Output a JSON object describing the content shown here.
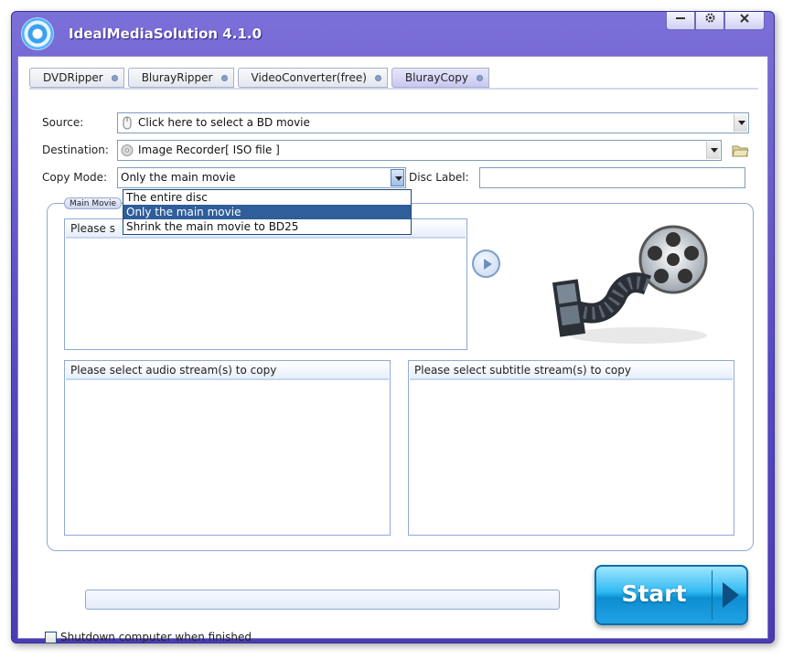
{
  "app": {
    "title": "IdealMediaSolution  4.1.0"
  },
  "window_controls": {
    "minimize_icon": "minimize-icon",
    "settings_icon": "gear-icon",
    "close_icon": "close-icon"
  },
  "tabs": [
    {
      "label": "DVDRipper",
      "active": false
    },
    {
      "label": "BlurayRipper",
      "active": false
    },
    {
      "label": "VideoConverter(free)",
      "active": false
    },
    {
      "label": "BlurayCopy",
      "active": true
    }
  ],
  "source": {
    "label": "Source:",
    "value": "Click here to select a BD movie",
    "icon": "mouse-icon"
  },
  "destination": {
    "label": "Destination:",
    "value": "Image Recorder[ ISO file ]",
    "icon": "disc-icon",
    "browse_icon": "folder-icon"
  },
  "copy_mode": {
    "label": "Copy Mode:",
    "value": "Only the main movie",
    "options": [
      "The entire disc",
      "Only the main movie",
      "Shrink the main movie to BD25"
    ],
    "selected_index": 1
  },
  "disc_label": {
    "label": "Disc Label:",
    "value": ""
  },
  "group": {
    "title": "Main Movie"
  },
  "lists": {
    "titles_header": "Please s",
    "audio_header": "Please select audio stream(s) to copy",
    "subtitle_header": "Please select subtitle stream(s) to copy"
  },
  "start_button": {
    "label": "Start"
  },
  "shutdown": {
    "label": "Shutdown computer when finished",
    "checked": false
  },
  "colors": {
    "window_frame": "#5547c2",
    "start_button": "#1fa2e4",
    "dropdown_selected": "#2f5e9b"
  }
}
